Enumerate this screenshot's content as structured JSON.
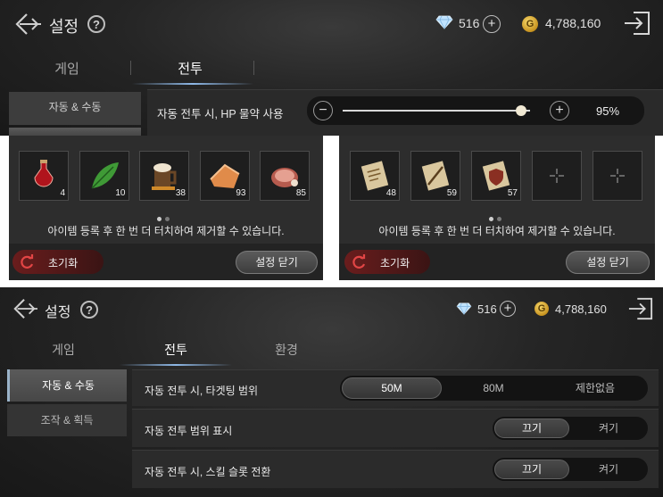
{
  "top": {
    "title": "설정",
    "help": "?",
    "diamonds": "516",
    "gold": "4,788,160",
    "gold_symbol": "G",
    "tabs": [
      "게임",
      "전투"
    ],
    "active_tab": 1,
    "sidebar": [
      "자동 & 수동"
    ],
    "setting_label": "자동 전투 시, HP 물약 사용",
    "minus": "−",
    "plus": "+",
    "hp_potion_percent": "95%",
    "hp_potion_value": 0.95
  },
  "panel_left": {
    "items": [
      {
        "name": "red-potion-icon",
        "count": "4"
      },
      {
        "name": "green-leaf-icon",
        "count": "10"
      },
      {
        "name": "mug-icon",
        "count": "38"
      },
      {
        "name": "bread-icon",
        "count": "93"
      },
      {
        "name": "meat-icon",
        "count": "85"
      }
    ],
    "hint": "아이템 등록 후 한 번 더 터치하여 제거할 수 있습니다.",
    "reset": "초기화",
    "close": "설정 닫기"
  },
  "panel_right": {
    "items": [
      {
        "name": "scroll-icon",
        "count": "48"
      },
      {
        "name": "scroll-feather-icon",
        "count": "59"
      },
      {
        "name": "scroll-shield-icon",
        "count": "57"
      },
      {
        "name": "empty-slot-icon",
        "count": ""
      },
      {
        "name": "empty-slot-icon",
        "count": ""
      }
    ],
    "hint": "아이템 등록 후 한 번 더 터치하여 제거할 수 있습니다.",
    "reset": "초기화",
    "close": "설정 닫기"
  },
  "bottom": {
    "title": "설정",
    "help": "?",
    "diamonds": "516",
    "gold": "4,788,160",
    "gold_symbol": "G",
    "tabs": [
      "게임",
      "전투",
      "환경"
    ],
    "active_tab": 1,
    "sidebar": [
      "자동 & 수동",
      "조작 & 획득"
    ],
    "rows": [
      {
        "label": "자동 전투 시, 타겟팅 범위",
        "options": [
          "50M",
          "80M",
          "제한없음"
        ],
        "selected": 0
      },
      {
        "label": "자동 전투 범위 표시",
        "options": [
          "끄기",
          "켜기"
        ],
        "selected": 0
      },
      {
        "label": "자동 전투 시, 스킬 슬롯 전환",
        "options": [
          "끄기",
          "켜기"
        ],
        "selected": 0
      }
    ]
  },
  "colors": {
    "accent_blue": "#8fb9e8",
    "reset_red": "#6a1d1d",
    "gold": "#c79320"
  }
}
